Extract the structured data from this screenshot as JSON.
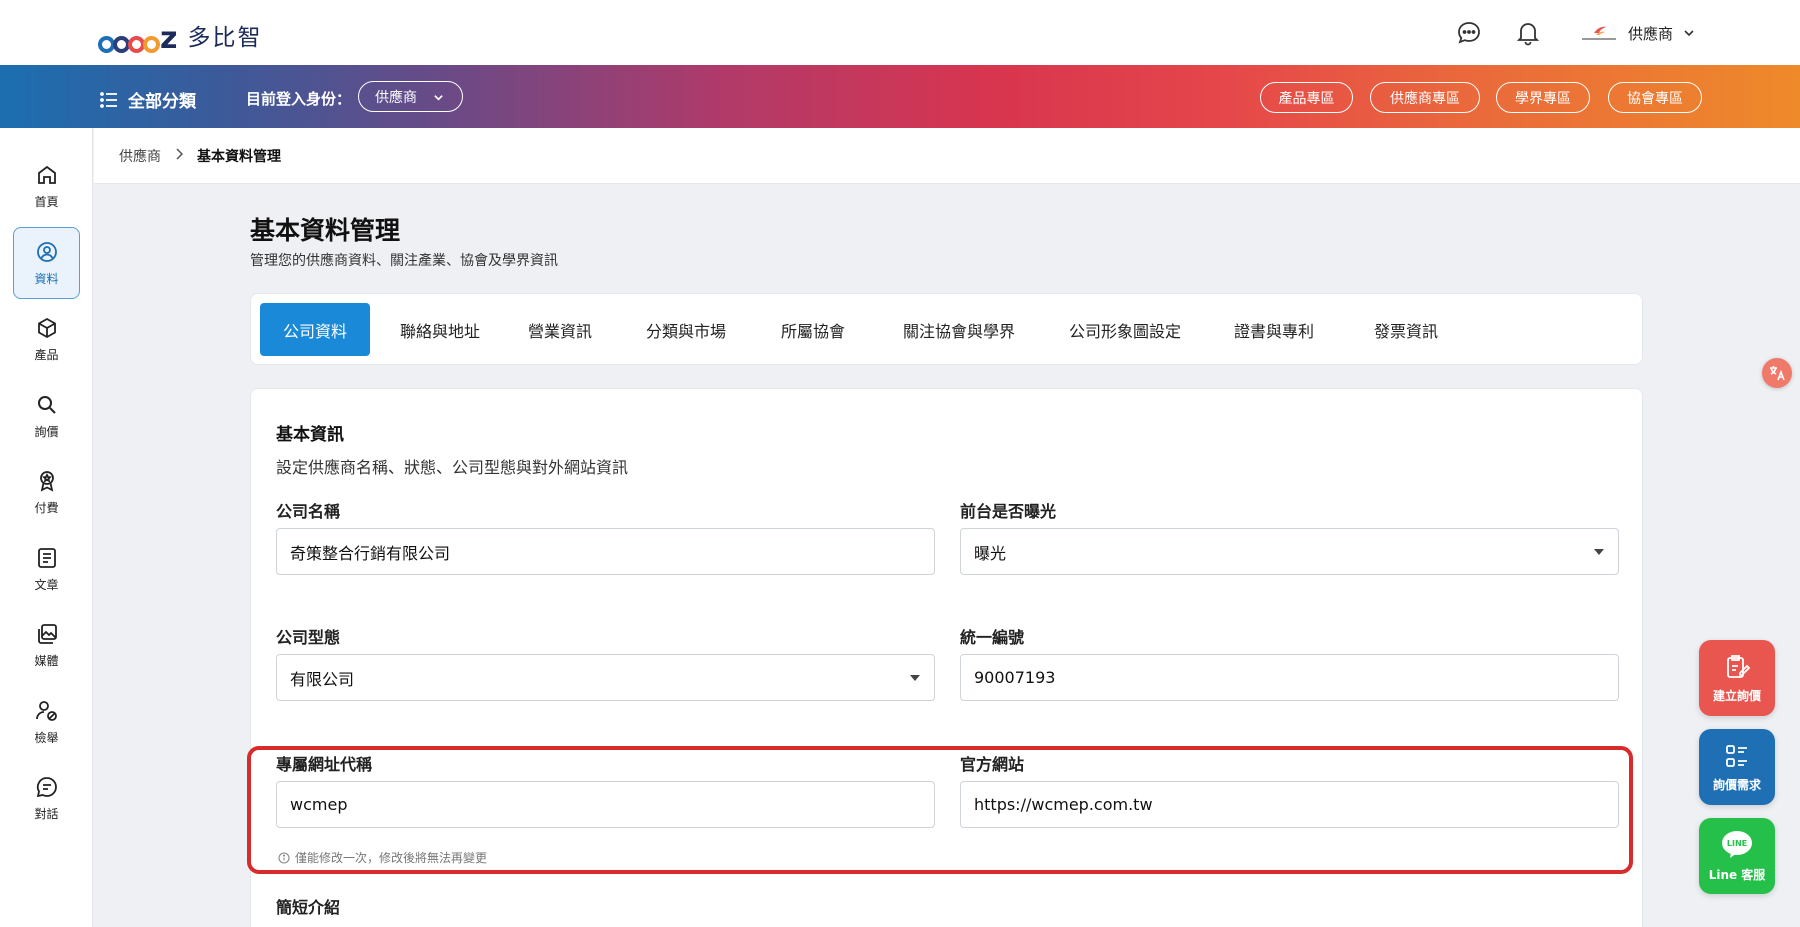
{
  "header": {
    "logo_text": "多比智",
    "user_name": "供應商"
  },
  "navbar": {
    "all_categories": "全部分類",
    "login_as_label": "目前登入身份：",
    "role_selected": "供應商",
    "pills": [
      "產品專區",
      "供應商專區",
      "學界專區",
      "協會專區"
    ]
  },
  "sidebar": {
    "items": [
      {
        "label": "首頁",
        "icon": "home-icon"
      },
      {
        "label": "資料",
        "icon": "user-circle-icon"
      },
      {
        "label": "產品",
        "icon": "cube-icon"
      },
      {
        "label": "詢價",
        "icon": "search-icon"
      },
      {
        "label": "付費",
        "icon": "badge-icon"
      },
      {
        "label": "文章",
        "icon": "document-icon"
      },
      {
        "label": "媒體",
        "icon": "media-icon"
      },
      {
        "label": "檢舉",
        "icon": "report-user-icon"
      },
      {
        "label": "對話",
        "icon": "chat-icon"
      }
    ],
    "active_index": 1
  },
  "breadcrumb": {
    "parent": "供應商",
    "current": "基本資料管理"
  },
  "page": {
    "title": "基本資料管理",
    "subtitle": "管理您的供應商資料、關注產業、協會及學界資訊"
  },
  "tabs": [
    "公司資料",
    "聯絡與地址",
    "營業資訊",
    "分類與市場",
    "所屬協會",
    "關注協會與學界",
    "公司形象圖設定",
    "證書與專利",
    "發票資訊"
  ],
  "form": {
    "section_title": "基本資訊",
    "section_desc": "設定供應商名稱、狀態、公司型態與對外網站資訊",
    "company_name_label": "公司名稱",
    "company_name_value": "奇策整合行銷有限公司",
    "exposure_label": "前台是否曝光",
    "exposure_value": "曝光",
    "company_type_label": "公司型態",
    "company_type_value": "有限公司",
    "tax_id_label": "統一編號",
    "tax_id_value": "90007193",
    "url_alias_label": "專屬網址代稱",
    "url_alias_value": "wcmep",
    "website_label": "官方網站",
    "website_value": "https://wcmep.com.tw",
    "hint": "僅能修改一次，修改後將無法再變更",
    "intro_label": "簡短介紹"
  },
  "floating": {
    "create_inquiry": "建立詢價",
    "inquiry_demand": "詢價需求",
    "line_service": "Line 客服",
    "line_logo": "LINE"
  },
  "colors": {
    "primary": "#1a8ad8",
    "highlight": "#d82c2c",
    "create_btn": "#e8564f",
    "demand_btn": "#1f6fb5",
    "line_btn": "#25c04a"
  }
}
